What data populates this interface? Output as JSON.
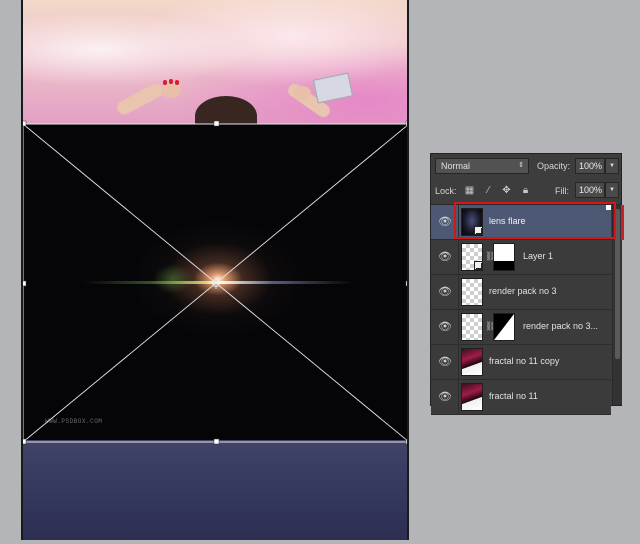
{
  "canvas": {
    "watermark": "WWW.PSDBOX.COM"
  },
  "layers_panel": {
    "blend_mode": "Normal",
    "opacity_label": "Opacity:",
    "opacity_value": "100%",
    "lock_label": "Lock:",
    "fill_label": "Fill:",
    "fill_value": "100%",
    "layers": [
      {
        "name": "lens flare",
        "thumb": "dark",
        "selected": true
      },
      {
        "name": "Layer 1",
        "thumb": "check",
        "mask": true
      },
      {
        "name": "render pack no 3",
        "thumb": "check"
      },
      {
        "name": "render pack no 3...",
        "thumb": "check",
        "mask": true
      },
      {
        "name": "fractal no 11 copy",
        "thumb": "fractal"
      },
      {
        "name": "fractal no 11",
        "thumb": "fractal"
      }
    ]
  },
  "colors": {
    "selection_highlight": "#d01818",
    "selected_row": "#4d5874"
  }
}
